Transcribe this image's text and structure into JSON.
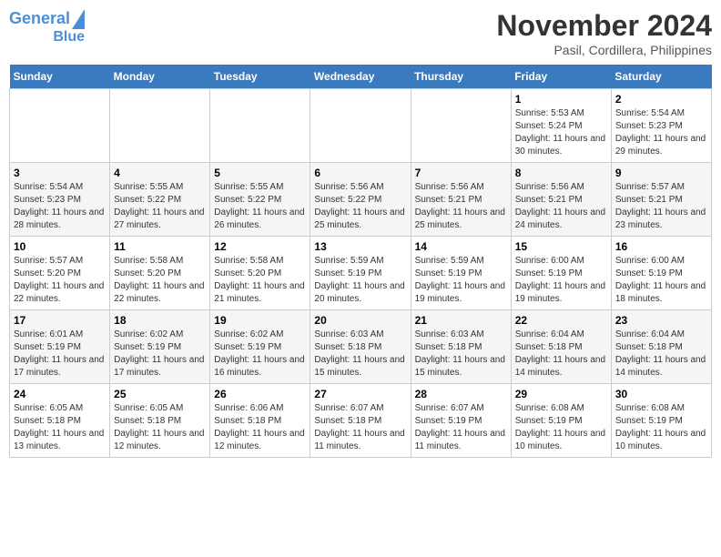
{
  "header": {
    "logo_line1": "General",
    "logo_line2": "Blue",
    "month": "November 2024",
    "location": "Pasil, Cordillera, Philippines"
  },
  "weekdays": [
    "Sunday",
    "Monday",
    "Tuesday",
    "Wednesday",
    "Thursday",
    "Friday",
    "Saturday"
  ],
  "weeks": [
    [
      {
        "day": "",
        "sunrise": "",
        "sunset": "",
        "daylight": ""
      },
      {
        "day": "",
        "sunrise": "",
        "sunset": "",
        "daylight": ""
      },
      {
        "day": "",
        "sunrise": "",
        "sunset": "",
        "daylight": ""
      },
      {
        "day": "",
        "sunrise": "",
        "sunset": "",
        "daylight": ""
      },
      {
        "day": "",
        "sunrise": "",
        "sunset": "",
        "daylight": ""
      },
      {
        "day": "1",
        "sunrise": "Sunrise: 5:53 AM",
        "sunset": "Sunset: 5:24 PM",
        "daylight": "Daylight: 11 hours and 30 minutes."
      },
      {
        "day": "2",
        "sunrise": "Sunrise: 5:54 AM",
        "sunset": "Sunset: 5:23 PM",
        "daylight": "Daylight: 11 hours and 29 minutes."
      }
    ],
    [
      {
        "day": "3",
        "sunrise": "Sunrise: 5:54 AM",
        "sunset": "Sunset: 5:23 PM",
        "daylight": "Daylight: 11 hours and 28 minutes."
      },
      {
        "day": "4",
        "sunrise": "Sunrise: 5:55 AM",
        "sunset": "Sunset: 5:22 PM",
        "daylight": "Daylight: 11 hours and 27 minutes."
      },
      {
        "day": "5",
        "sunrise": "Sunrise: 5:55 AM",
        "sunset": "Sunset: 5:22 PM",
        "daylight": "Daylight: 11 hours and 26 minutes."
      },
      {
        "day": "6",
        "sunrise": "Sunrise: 5:56 AM",
        "sunset": "Sunset: 5:22 PM",
        "daylight": "Daylight: 11 hours and 25 minutes."
      },
      {
        "day": "7",
        "sunrise": "Sunrise: 5:56 AM",
        "sunset": "Sunset: 5:21 PM",
        "daylight": "Daylight: 11 hours and 25 minutes."
      },
      {
        "day": "8",
        "sunrise": "Sunrise: 5:56 AM",
        "sunset": "Sunset: 5:21 PM",
        "daylight": "Daylight: 11 hours and 24 minutes."
      },
      {
        "day": "9",
        "sunrise": "Sunrise: 5:57 AM",
        "sunset": "Sunset: 5:21 PM",
        "daylight": "Daylight: 11 hours and 23 minutes."
      }
    ],
    [
      {
        "day": "10",
        "sunrise": "Sunrise: 5:57 AM",
        "sunset": "Sunset: 5:20 PM",
        "daylight": "Daylight: 11 hours and 22 minutes."
      },
      {
        "day": "11",
        "sunrise": "Sunrise: 5:58 AM",
        "sunset": "Sunset: 5:20 PM",
        "daylight": "Daylight: 11 hours and 22 minutes."
      },
      {
        "day": "12",
        "sunrise": "Sunrise: 5:58 AM",
        "sunset": "Sunset: 5:20 PM",
        "daylight": "Daylight: 11 hours and 21 minutes."
      },
      {
        "day": "13",
        "sunrise": "Sunrise: 5:59 AM",
        "sunset": "Sunset: 5:19 PM",
        "daylight": "Daylight: 11 hours and 20 minutes."
      },
      {
        "day": "14",
        "sunrise": "Sunrise: 5:59 AM",
        "sunset": "Sunset: 5:19 PM",
        "daylight": "Daylight: 11 hours and 19 minutes."
      },
      {
        "day": "15",
        "sunrise": "Sunrise: 6:00 AM",
        "sunset": "Sunset: 5:19 PM",
        "daylight": "Daylight: 11 hours and 19 minutes."
      },
      {
        "day": "16",
        "sunrise": "Sunrise: 6:00 AM",
        "sunset": "Sunset: 5:19 PM",
        "daylight": "Daylight: 11 hours and 18 minutes."
      }
    ],
    [
      {
        "day": "17",
        "sunrise": "Sunrise: 6:01 AM",
        "sunset": "Sunset: 5:19 PM",
        "daylight": "Daylight: 11 hours and 17 minutes."
      },
      {
        "day": "18",
        "sunrise": "Sunrise: 6:02 AM",
        "sunset": "Sunset: 5:19 PM",
        "daylight": "Daylight: 11 hours and 17 minutes."
      },
      {
        "day": "19",
        "sunrise": "Sunrise: 6:02 AM",
        "sunset": "Sunset: 5:19 PM",
        "daylight": "Daylight: 11 hours and 16 minutes."
      },
      {
        "day": "20",
        "sunrise": "Sunrise: 6:03 AM",
        "sunset": "Sunset: 5:18 PM",
        "daylight": "Daylight: 11 hours and 15 minutes."
      },
      {
        "day": "21",
        "sunrise": "Sunrise: 6:03 AM",
        "sunset": "Sunset: 5:18 PM",
        "daylight": "Daylight: 11 hours and 15 minutes."
      },
      {
        "day": "22",
        "sunrise": "Sunrise: 6:04 AM",
        "sunset": "Sunset: 5:18 PM",
        "daylight": "Daylight: 11 hours and 14 minutes."
      },
      {
        "day": "23",
        "sunrise": "Sunrise: 6:04 AM",
        "sunset": "Sunset: 5:18 PM",
        "daylight": "Daylight: 11 hours and 14 minutes."
      }
    ],
    [
      {
        "day": "24",
        "sunrise": "Sunrise: 6:05 AM",
        "sunset": "Sunset: 5:18 PM",
        "daylight": "Daylight: 11 hours and 13 minutes."
      },
      {
        "day": "25",
        "sunrise": "Sunrise: 6:05 AM",
        "sunset": "Sunset: 5:18 PM",
        "daylight": "Daylight: 11 hours and 12 minutes."
      },
      {
        "day": "26",
        "sunrise": "Sunrise: 6:06 AM",
        "sunset": "Sunset: 5:18 PM",
        "daylight": "Daylight: 11 hours and 12 minutes."
      },
      {
        "day": "27",
        "sunrise": "Sunrise: 6:07 AM",
        "sunset": "Sunset: 5:18 PM",
        "daylight": "Daylight: 11 hours and 11 minutes."
      },
      {
        "day": "28",
        "sunrise": "Sunrise: 6:07 AM",
        "sunset": "Sunset: 5:19 PM",
        "daylight": "Daylight: 11 hours and 11 minutes."
      },
      {
        "day": "29",
        "sunrise": "Sunrise: 6:08 AM",
        "sunset": "Sunset: 5:19 PM",
        "daylight": "Daylight: 11 hours and 10 minutes."
      },
      {
        "day": "30",
        "sunrise": "Sunrise: 6:08 AM",
        "sunset": "Sunset: 5:19 PM",
        "daylight": "Daylight: 11 hours and 10 minutes."
      }
    ]
  ]
}
